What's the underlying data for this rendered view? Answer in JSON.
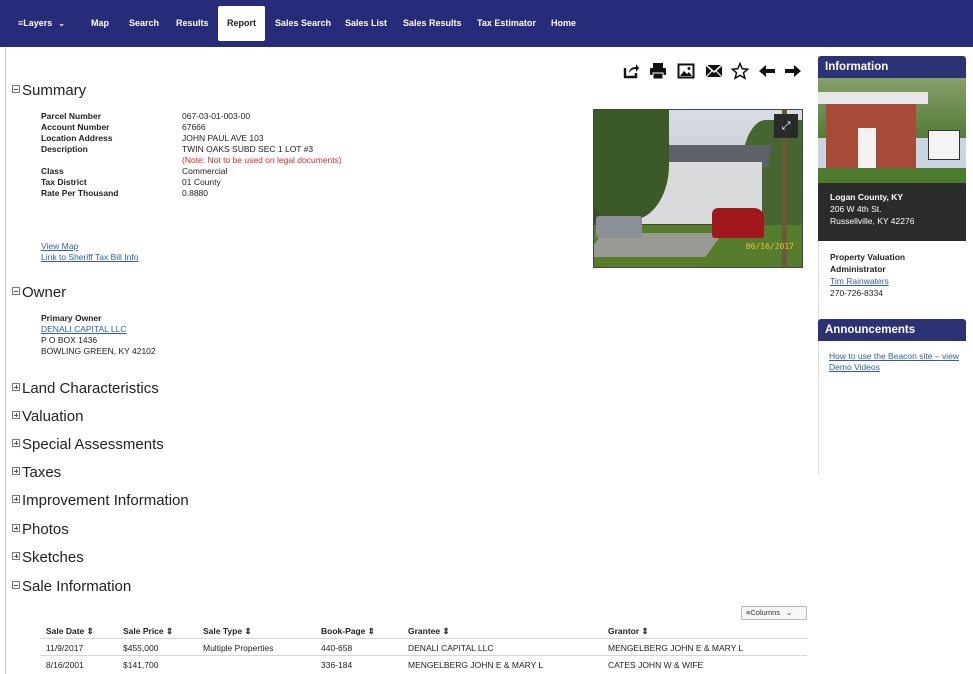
{
  "nav": {
    "layers": "Layers",
    "items": [
      "Map",
      "Search",
      "Results",
      "Report",
      "Sales Search",
      "Sales List",
      "Sales Results",
      "Tax Estimator",
      "Home"
    ]
  },
  "toolbar": {
    "icons": [
      "share-icon",
      "print-icon",
      "image-icon",
      "email-icon",
      "star-icon",
      "arrow-left-icon",
      "arrow-right-icon"
    ]
  },
  "summary": {
    "title": "Summary",
    "rows": [
      {
        "label": "Parcel Number",
        "value": "067-03-01-003-00"
      },
      {
        "label": "Account Number",
        "value": "67666"
      },
      {
        "label": "Location Address",
        "value": "JOHN PAUL AVE 103"
      },
      {
        "label": "Description",
        "value": "TWIN OAKS SUBD SEC 1 LOT #3"
      },
      {
        "label": "Class",
        "value": "Commercial"
      },
      {
        "label": "Tax District",
        "value": "01 County"
      },
      {
        "label": "Rate Per Thousand",
        "value": "0.8880"
      }
    ],
    "note": "(Note: Not to be used on legal documents)",
    "view_map": "View Map",
    "sheriff_link": "Link to Sheriff Tax Bill Info",
    "photo_date": "06/16/2017"
  },
  "owner": {
    "title": "Owner",
    "label": "Primary Owner",
    "name": "DENALI CAPITAL LLC",
    "address1": "P O BOX 1436",
    "address2": "BOWLING GREEN, KY 42102"
  },
  "collapsed_sections": [
    "Land Characteristics",
    "Valuation",
    "Special Assessments",
    "Taxes",
    "Improvement Information",
    "Photos",
    "Sketches"
  ],
  "sale": {
    "title": "Sale Information",
    "columns_button": "Columns",
    "headers": [
      "Sale Date",
      "Sale Price",
      "Sale Type",
      "Book-Page",
      "Grantee",
      "Grantor"
    ],
    "rows": [
      [
        "11/9/2017",
        "$455,000",
        "Multiple Properties",
        "440-658",
        "DENALI CAPITAL LLC",
        "MENGELBERG JOHN E & MARY L"
      ],
      [
        "8/16/2001",
        "$141,700",
        "",
        "336-184",
        "MENGELBERG JOHN E & MARY L",
        "CATES JOHN W & WIFE"
      ]
    ]
  },
  "sidebar": {
    "info_title": "Information",
    "office_name": "Logan County, KY",
    "office_street": "206 W 4th St.",
    "office_city": "Russellville, KY 42276",
    "pva_title1": "Property Valuation",
    "pva_title2": "Administrator",
    "pva_name": "Tim Rainwaters",
    "pva_phone": "270-726-8334",
    "announcements_title": "Announcements",
    "announcement_link1": "How to use the Beacon site – view",
    "announcement_link2": "Demo Videos"
  },
  "colors": {
    "nav_bg": "#262b7a",
    "sidebar_head_bg": "#2c3374",
    "link": "#2f5fa8",
    "note": "#d12b2b"
  }
}
